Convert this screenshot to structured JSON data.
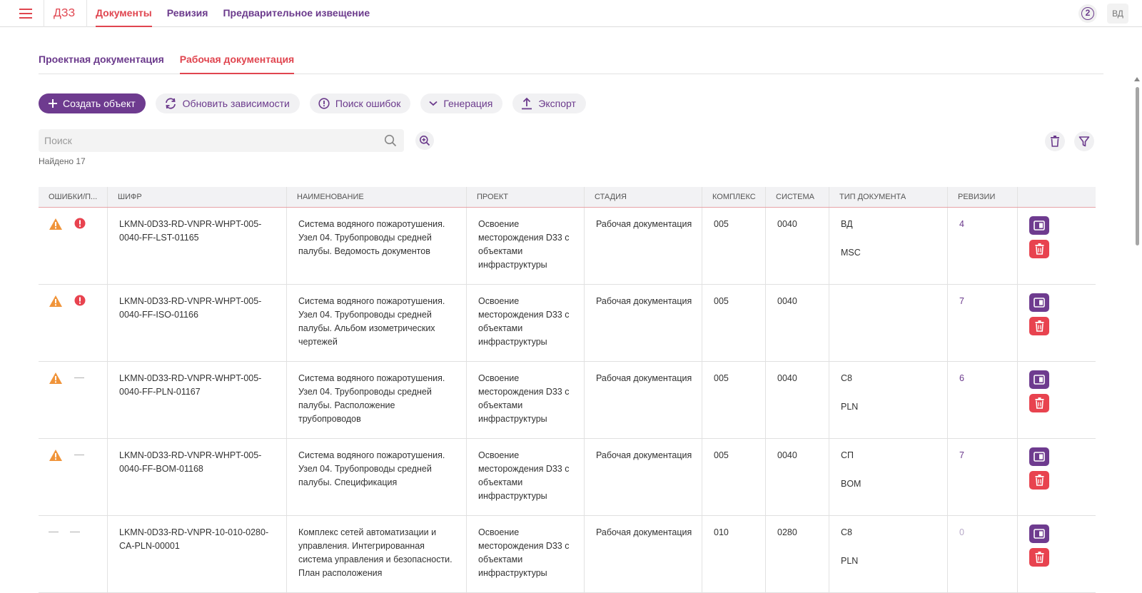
{
  "app": {
    "brand": "ДЗЗ",
    "nav": [
      {
        "label": "Документы",
        "active": true
      },
      {
        "label": "Ревизия",
        "active": false
      },
      {
        "label": "Предварительное извещение",
        "active": false
      }
    ],
    "help_label": "2",
    "user_initials": "ВД"
  },
  "subtabs": [
    {
      "label": "Проектная документация",
      "active": false
    },
    {
      "label": "Рабочая документация",
      "active": true
    }
  ],
  "toolbar": {
    "create": "Создать объект",
    "refresh": "Обновить зависимости",
    "errors": "Поиск ошибок",
    "generate": "Генерация",
    "export": "Экспорт"
  },
  "search": {
    "placeholder": "Поиск",
    "value": ""
  },
  "found_text": "Найдено 17",
  "colors": {
    "accent": "#6e3b8f",
    "danger": "#e8434f",
    "warning": "#f0943a",
    "brand": "#e0454f"
  },
  "table": {
    "headers": [
      "Ошибки/П...",
      "Шифр",
      "Наименование",
      "Проект",
      "Стадия",
      "Комплекс",
      "Система",
      "Тип документа",
      "Ревизии",
      ""
    ],
    "rows": [
      {
        "warning": true,
        "error": true,
        "code": "LKMN-0D33-RD-VNPR-WHPT-005-0040-FF-LST-01165",
        "name": "Система водяного пожаротушения. Узел 04. Трубопроводы средней палубы. Ведомость документов",
        "project": "Освоение месторождения D33 с объектами инфраструктуры",
        "stage": "Рабочая документация",
        "complex": "005",
        "system": "0040",
        "type1": "ВД",
        "type2": "MSC",
        "revisions": "4"
      },
      {
        "warning": true,
        "error": true,
        "code": "LKMN-0D33-RD-VNPR-WHPT-005-0040-FF-ISO-01166",
        "name": "Система водяного пожаротушения. Узел 04. Трубопроводы средней палубы. Альбом изометрических чертежей",
        "project": "Освоение месторождения D33 с объектами инфраструктуры",
        "stage": "Рабочая документация",
        "complex": "005",
        "system": "0040",
        "type1": "",
        "type2": "",
        "revisions": "7"
      },
      {
        "warning": true,
        "error": false,
        "code": "LKMN-0D33-RD-VNPR-WHPT-005-0040-FF-PLN-01167",
        "name": "Система водяного пожаротушения. Узел 04. Трубопроводы средней палубы. Расположение трубопроводов",
        "project": "Освоение месторождения D33 с объектами инфраструктуры",
        "stage": "Рабочая документация",
        "complex": "005",
        "system": "0040",
        "type1": "С8",
        "type2": "PLN",
        "revisions": "6"
      },
      {
        "warning": true,
        "error": false,
        "code": "LKMN-0D33-RD-VNPR-WHPT-005-0040-FF-BOM-01168",
        "name": "Система водяного пожаротушения. Узел 04. Трубопроводы средней палубы. Спецификация",
        "project": "Освоение месторождения D33 с объектами инфраструктуры",
        "stage": "Рабочая документация",
        "complex": "005",
        "system": "0040",
        "type1": "СП",
        "type2": "BOM",
        "revisions": "7"
      },
      {
        "warning": false,
        "error": false,
        "code": "LKMN-0D33-RD-VNPR-10-010-0280-CA-PLN-00001",
        "name": "Комплекс сетей автоматизации и управления. Интегрированная система управления и безопасности. План расположения",
        "project": "Освоение месторождения D33 с объектами инфраструктуры",
        "stage": "Рабочая документация",
        "complex": "010",
        "system": "0280",
        "type1": "С8",
        "type2": "PLN",
        "revisions": "0"
      }
    ]
  }
}
